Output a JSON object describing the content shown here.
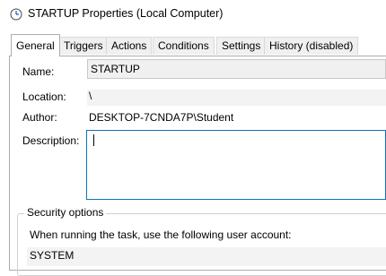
{
  "window": {
    "title": "STARTUP Properties (Local Computer)",
    "icon": "clock-icon"
  },
  "tabs": [
    {
      "label": "General",
      "active": true
    },
    {
      "label": "Triggers"
    },
    {
      "label": "Actions"
    },
    {
      "label": "Conditions"
    },
    {
      "label": "Settings"
    },
    {
      "label": "History (disabled)"
    }
  ],
  "general": {
    "name_label": "Name:",
    "name_value": "STARTUP",
    "location_label": "Location:",
    "location_value": "\\",
    "author_label": "Author:",
    "author_value": "DESKTOP-7CNDA7P\\Student",
    "description_label": "Description:",
    "description_value": ""
  },
  "security": {
    "group_label": "Security options",
    "account_prompt": "When running the task, use the following user account:",
    "account_value": "SYSTEM"
  }
}
